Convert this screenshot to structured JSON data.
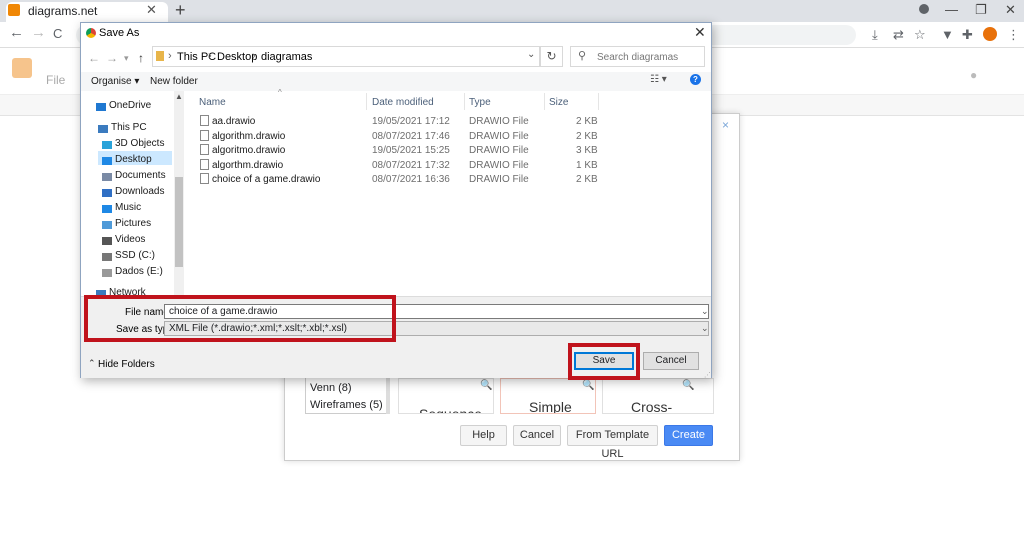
{
  "browser": {
    "tab_title": "diagrams.net",
    "tab_close": "✕",
    "new_tab": "+",
    "window_controls": [
      "—",
      "❐",
      "✕"
    ],
    "nav": [
      "←",
      "→",
      "C"
    ]
  },
  "app": {
    "menu_file": "File"
  },
  "new_diagram": {
    "close": "×",
    "categories": [
      "Venn (8)",
      "Wireframes (5)"
    ],
    "thumbs": [
      "Sequence",
      "Simple",
      "Cross-"
    ],
    "buttons": {
      "help": "Help",
      "cancel": "Cancel",
      "template_url": "From Template URL",
      "create": "Create"
    }
  },
  "save_dialog": {
    "title": "Save As",
    "close": "✕",
    "breadcrumb": [
      "This PC",
      "Desktop",
      "diagramas"
    ],
    "search_placeholder": "Search diagramas",
    "organise": "Organise ▾",
    "new_folder": "New folder",
    "help": "?",
    "nav_items": [
      {
        "label": "OneDrive",
        "icon": "onedrive-icon"
      },
      {
        "label": "This PC",
        "icon": "pc-icon"
      },
      {
        "label": "3D Objects",
        "icon": "3d-objects-icon"
      },
      {
        "label": "Desktop",
        "icon": "desktop-icon"
      },
      {
        "label": "Documents",
        "icon": "documents-icon"
      },
      {
        "label": "Downloads",
        "icon": "downloads-icon"
      },
      {
        "label": "Music",
        "icon": "music-icon"
      },
      {
        "label": "Pictures",
        "icon": "pictures-icon"
      },
      {
        "label": "Videos",
        "icon": "videos-icon"
      },
      {
        "label": "SSD (C:)",
        "icon": "drive-icon"
      },
      {
        "label": "Dados (E:)",
        "icon": "drive-icon"
      },
      {
        "label": "Network",
        "icon": "network-icon"
      }
    ],
    "columns": [
      "Name",
      "Date modified",
      "Type",
      "Size"
    ],
    "files": [
      {
        "name": "aa.drawio",
        "date": "19/05/2021 17:12",
        "type": "DRAWIO File",
        "size": "2 KB"
      },
      {
        "name": "algorithm.drawio",
        "date": "08/07/2021 17:46",
        "type": "DRAWIO File",
        "size": "2 KB"
      },
      {
        "name": "algoritmo.drawio",
        "date": "19/05/2021 15:25",
        "type": "DRAWIO File",
        "size": "3 KB"
      },
      {
        "name": "algorthm.drawio",
        "date": "08/07/2021 17:32",
        "type": "DRAWIO File",
        "size": "1 KB"
      },
      {
        "name": "choice of a game.drawio",
        "date": "08/07/2021 16:36",
        "type": "DRAWIO File",
        "size": "2 KB"
      }
    ],
    "file_name_label": "File name:",
    "file_name_value": "choice of a game.drawio",
    "save_type_label": "Save as type:",
    "save_type_value": "XML File (*.drawio;*.xml;*.xslt;*.xbl;*.xsl)",
    "hide_folders": "Hide Folders",
    "save_button": "Save",
    "cancel_button": "Cancel"
  },
  "colors": {
    "highlight": "#c0131c",
    "create_button": "#4a8af4",
    "selected_nav": "#cce8ff"
  }
}
